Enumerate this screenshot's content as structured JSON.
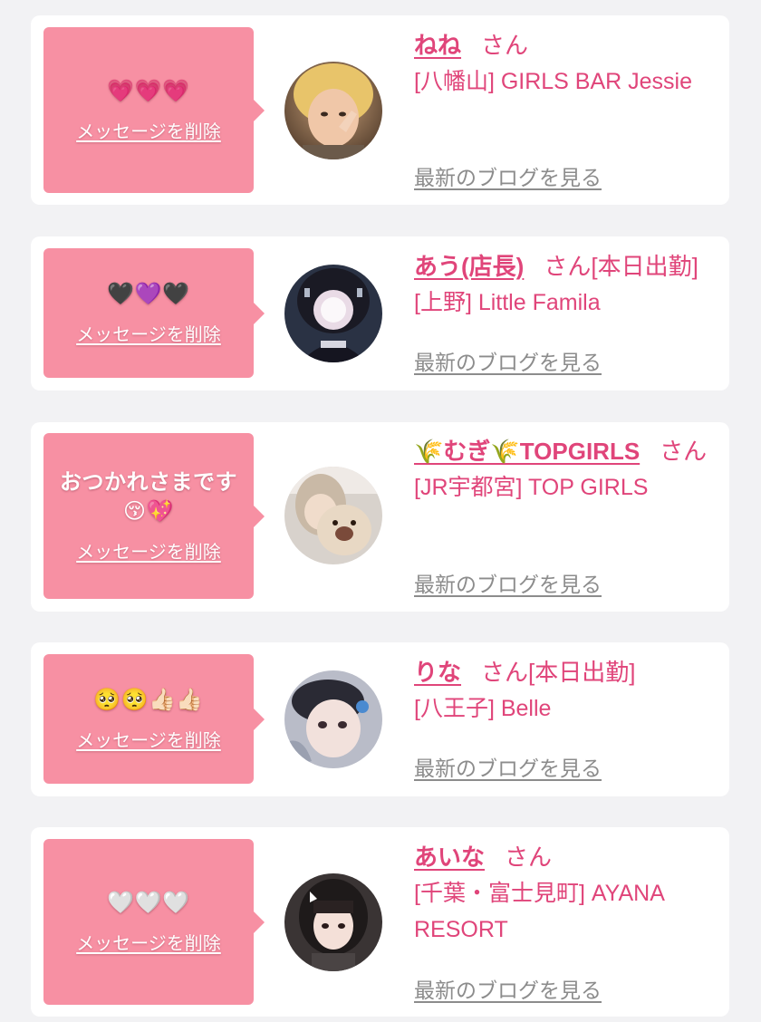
{
  "messages": [
    {
      "bubble_text": "💗💗💗",
      "delete_label": "メッセージを削除",
      "name": "ねね",
      "honorific": "さん",
      "status": "",
      "shop": "[八幡山] GIRLS BAR Jessie",
      "blog_label": "最新のブログを見る"
    },
    {
      "bubble_text": "🖤💜🖤",
      "delete_label": "メッセージを削除",
      "name": "あう(店長)",
      "honorific": "さん",
      "status": "[本日出勤]",
      "shop": "[上野] Little Famila",
      "blog_label": "最新のブログを見る"
    },
    {
      "bubble_text": "おつかれさまです😚💖",
      "delete_label": "メッセージを削除",
      "name": "🌾むぎ🌾TOPGIRLS",
      "honorific": "さん",
      "status": "",
      "shop": "[JR宇都宮] TOP GIRLS",
      "blog_label": "最新のブログを見る"
    },
    {
      "bubble_text": "🥺🥺👍🏻👍🏻",
      "delete_label": "メッセージを削除",
      "name": "りな",
      "honorific": "さん",
      "status": "[本日出勤]",
      "shop": "[八王子] Belle",
      "blog_label": "最新のブログを見る"
    },
    {
      "bubble_text": "🤍🤍🤍",
      "delete_label": "メッセージを削除",
      "name": "あいな",
      "honorific": "さん",
      "status": "",
      "shop": "[千葉・富士見町] AYANA RESORT",
      "blog_label": "最新のブログを見る"
    }
  ],
  "colors": {
    "accent": "#e0457a",
    "bubble": "#f790a3",
    "muted": "#8c8c8c",
    "background": "#f2f2f4"
  }
}
